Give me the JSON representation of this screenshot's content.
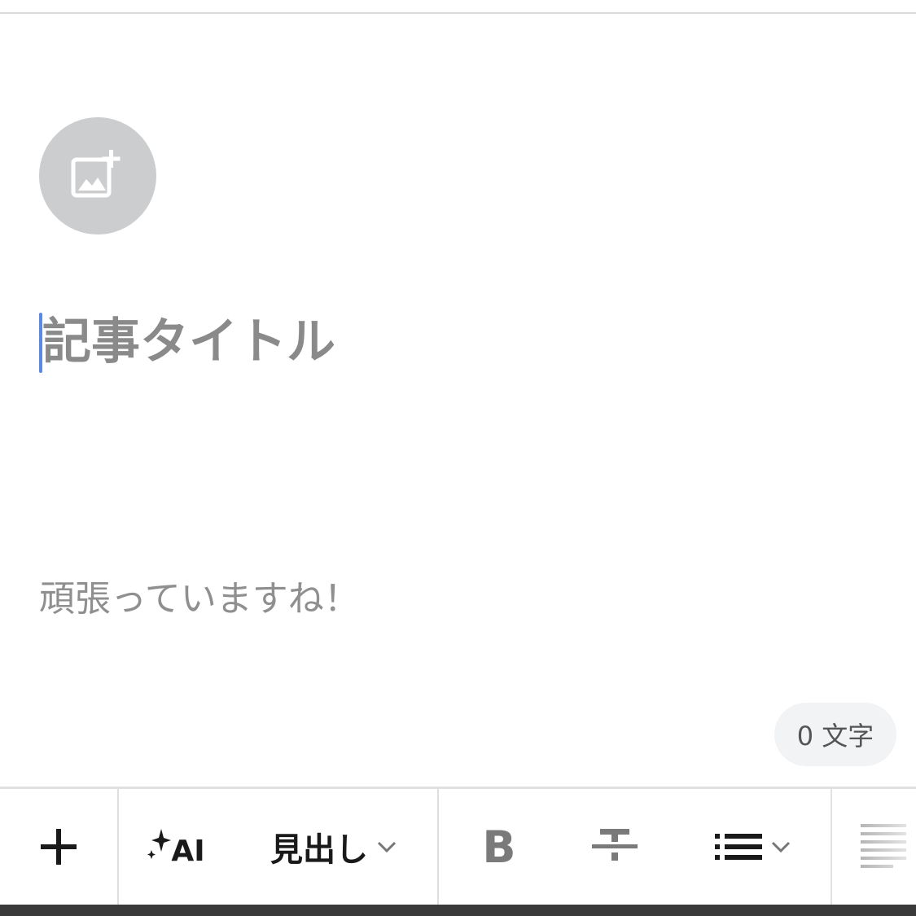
{
  "editor": {
    "cover_image_icon": "add-image-icon",
    "title_placeholder": "記事タイトル",
    "body_placeholder": "頑張っていますね！",
    "char_count": "0 文字"
  },
  "toolbar": {
    "add_icon": "plus-icon",
    "ai_label": "AI",
    "heading_label": "見出し",
    "bold_label": "B",
    "strikethrough_icon": "strikethrough-icon",
    "list_icon": "list-icon",
    "align_icon": "align-icon"
  },
  "colors": {
    "caret": "#5b8be0",
    "cover_circle": "#cccdcf",
    "placeholder_text": "#8a8a8a"
  }
}
